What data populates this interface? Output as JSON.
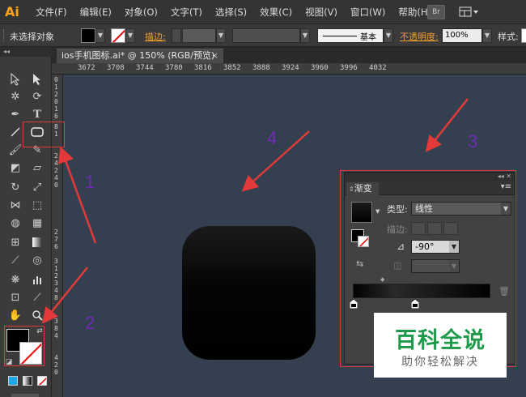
{
  "app": {
    "logo": "Ai"
  },
  "menu": [
    "文件(F)",
    "编辑(E)",
    "对象(O)",
    "文字(T)",
    "选择(S)",
    "效果(C)",
    "视图(V)",
    "窗口(W)",
    "帮助(H)"
  ],
  "menu_bridge_label": "Br",
  "control_bar": {
    "selection_state": "未选择对象",
    "stroke_label": "描边:",
    "stroke_style": "基本",
    "opacity_label": "不透明度:",
    "opacity_value": "100%",
    "style_label": "样式:"
  },
  "document_tab": {
    "title": "ios手机图标.ai* @ 150% (RGB/预览)",
    "close": "×"
  },
  "ruler_top": [
    "3672",
    "3708",
    "3744",
    "3780",
    "3816",
    "3852",
    "3888",
    "3924",
    "3960",
    "3996",
    "4032"
  ],
  "ruler_left_digits": [
    "0",
    "1",
    "2",
    "0",
    "1",
    "6",
    "8",
    "1",
    "2",
    "4",
    "2",
    "4",
    "0",
    "2",
    "7",
    "6",
    "3",
    "1",
    "2",
    "3",
    "4",
    "8",
    "3",
    "8",
    "4",
    "4",
    "2",
    "0"
  ],
  "gradient_panel": {
    "tab": "渐变",
    "type_label": "类型:",
    "type_value": "线性",
    "stroke_label": "描边:",
    "angle_value": "-90°",
    "angle_icon": "angle-icon"
  },
  "annotations": [
    "1",
    "2",
    "3",
    "4"
  ],
  "watermark": {
    "title": "百科全说",
    "subtitle": "助你轻松解决"
  },
  "colors": {
    "canvas": "#34404f",
    "annotation_arrow": "#e23a3a",
    "annotation_number": "#6f2bb5",
    "watermark_green": "#1e9b4a",
    "ai_orange": "#f7a31c"
  }
}
